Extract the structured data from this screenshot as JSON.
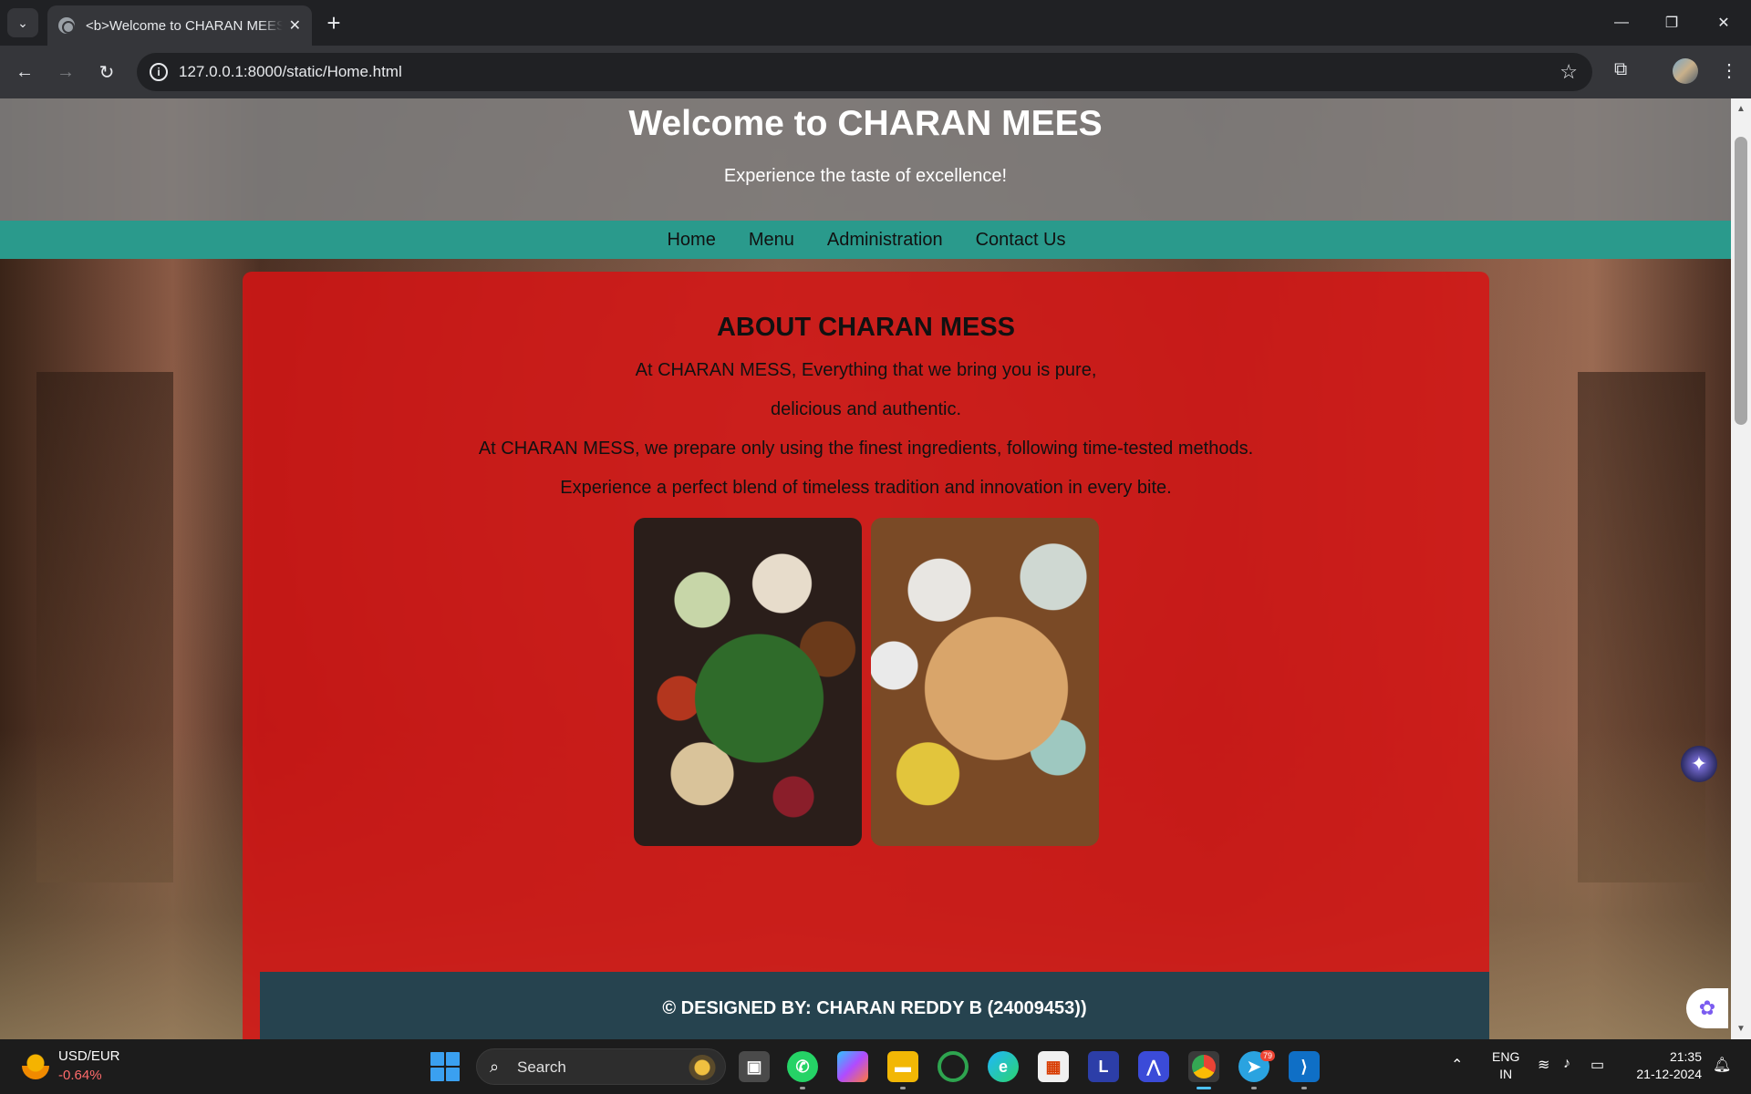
{
  "browser": {
    "tab_title": "<b>Welcome to CHARAN MEES",
    "tab_close": "✕",
    "new_tab": "+",
    "url": "127.0.0.1:8000/static/Home.html",
    "window_controls": {
      "minimize": "—",
      "restore": "❐",
      "close": "✕"
    }
  },
  "site": {
    "title": "Welcome to CHARAN MEES",
    "tagline": "Experience the taste of excellence!",
    "nav": [
      "Home",
      "Menu",
      "Administration",
      "Contact Us"
    ],
    "about": {
      "heading": "ABOUT CHARAN MESS",
      "paragraphs": [
        "At CHARAN MESS, Everything that we bring you is pure,",
        "delicious and authentic.",
        "At CHARAN MESS, we prepare only using the finest ingredients, following time-tested methods.",
        "Experience a perfect blend of timeless tradition and innovation in every bite."
      ],
      "images": [
        "south-indian-meal-photo",
        "pizza-spread-photo"
      ]
    },
    "footer": "© DESIGNED BY: CHARAN REDDY B (24009453))"
  },
  "taskbar": {
    "ticker_pair": "USD/EUR",
    "ticker_change": "-0.64%",
    "search_placeholder": "Search",
    "lang_line1": "ENG",
    "lang_line2": "IN",
    "time": "21:35",
    "date": "21-12-2024",
    "telegram_badge": "79",
    "apps": [
      "task-view-icon",
      "whatsapp-icon",
      "copilot-icon",
      "file-explorer-icon",
      "spinner-app-icon",
      "edge-icon",
      "store-icon",
      "l-app-icon",
      "arc-app-icon",
      "chrome-icon",
      "telegram-icon",
      "vscode-icon"
    ]
  },
  "colors": {
    "nav_bar": "#2a9a8c",
    "about_card": "#d61414",
    "footer": "#26434f",
    "header_overlay": "#808080"
  }
}
